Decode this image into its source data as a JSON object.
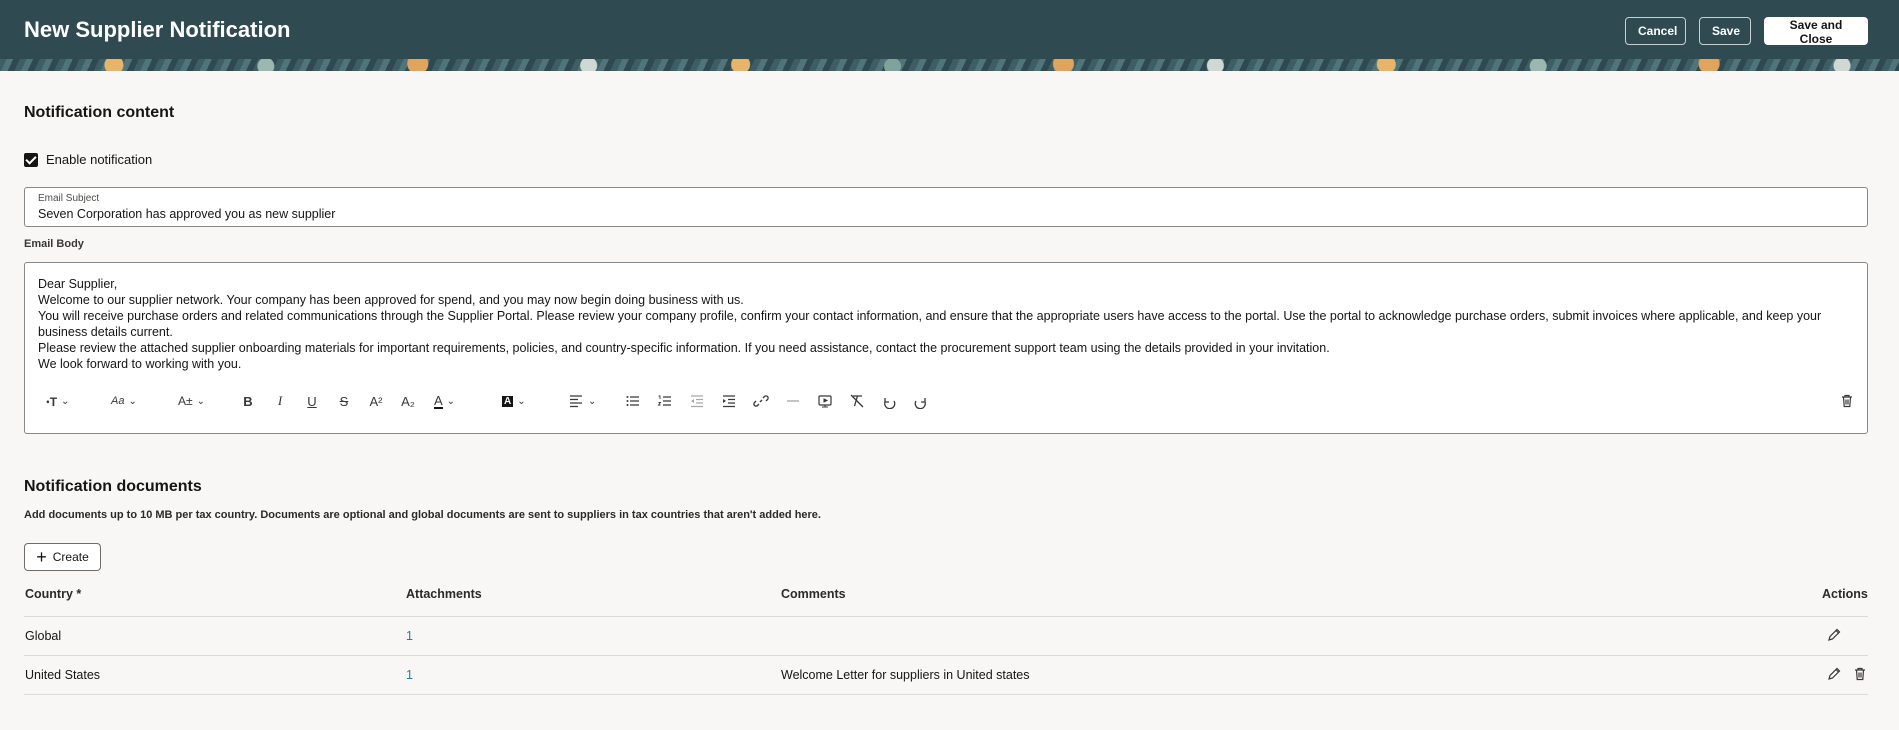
{
  "header": {
    "title": "New Supplier Notification",
    "cancel_label": "Cancel",
    "save_label": "Save",
    "save_close_label": "Save and Close"
  },
  "content": {
    "section_title": "Notification content",
    "enable_label": "Enable notification",
    "enable_checked": true,
    "subject_label": "Email Subject",
    "subject_value": "Seven Corporation has approved you as new supplier",
    "body_label": "Email Body",
    "body_lines": [
      "Dear Supplier,",
      "Welcome to our supplier network. Your company has been approved for spend, and you may now begin doing business with us.",
      "You will receive purchase orders and related communications through the Supplier Portal. Please review your company profile, confirm your contact information, and ensure that the appropriate users have access to the portal. Use the portal to acknowledge purchase orders, submit invoices where applicable, and keep your business details current.",
      "Please review the attached supplier onboarding materials for important requirements, policies, and country-specific information. If you need assistance, contact the procurement support team using the details provided in your invitation.",
      "We look forward to working with you."
    ]
  },
  "documents": {
    "section_title": "Notification documents",
    "description": "Add documents up to 10 MB per tax country. Documents are optional and global documents are sent to suppliers in tax countries that aren't added here.",
    "create_label": "Create",
    "columns": [
      "Country *",
      "Attachments",
      "Comments",
      "Actions"
    ],
    "rows": [
      {
        "country": "Global",
        "attachments": "1",
        "comments": ""
      },
      {
        "country": "United States",
        "attachments": "1",
        "comments": "Welcome Letter for suppliers in United states"
      }
    ]
  }
}
